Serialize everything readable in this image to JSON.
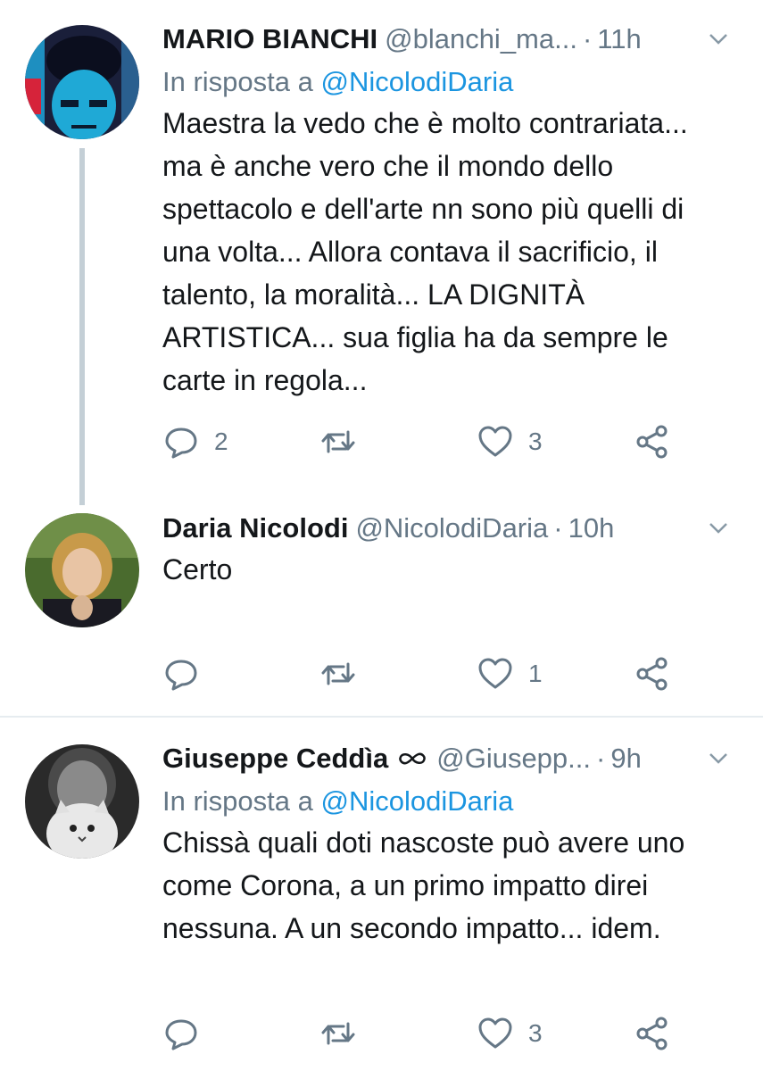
{
  "tweets": [
    {
      "name": "MARIO BIANCHI",
      "handle": "@blanchi_ma...",
      "dot": "·",
      "time": "11h",
      "reply_prefix": "In risposta a",
      "reply_mention": "@NicolodiDaria",
      "text": "Maestra la vedo che è molto contrariata... ma è anche vero che il mondo dello spettacolo e dell'arte nn sono più quelli di una volta... Allora contava il sacrificio, il talento, la moralità... LA DIGNITÀ ARTISTICA... sua figlia ha da sempre le carte in regola...",
      "replies": "2",
      "likes": "3"
    },
    {
      "name": "Daria Nicolodi",
      "handle": "@NicolodiDaria",
      "dot": "·",
      "time": "10h",
      "text": "Certo",
      "replies": "",
      "likes": "1"
    },
    {
      "name": "Giuseppe Ceddìa",
      "handle": "@Giusepp...",
      "dot": "·",
      "time": "9h",
      "reply_prefix": "In risposta a",
      "reply_mention": "@NicolodiDaria",
      "text": "Chissà quali doti nascoste può avere uno come Corona, a un primo impatto direi nessuna. A un secondo impatto... idem.",
      "replies": "",
      "likes": "3"
    }
  ],
  "colors": {
    "text": "#14171a",
    "muted": "#657786",
    "link": "#1b95e0",
    "thread": "#c4cfd6"
  },
  "icons": [
    "reply-icon",
    "retweet-icon",
    "like-icon",
    "share-icon",
    "chevron-down-icon",
    "infinity-icon"
  ]
}
